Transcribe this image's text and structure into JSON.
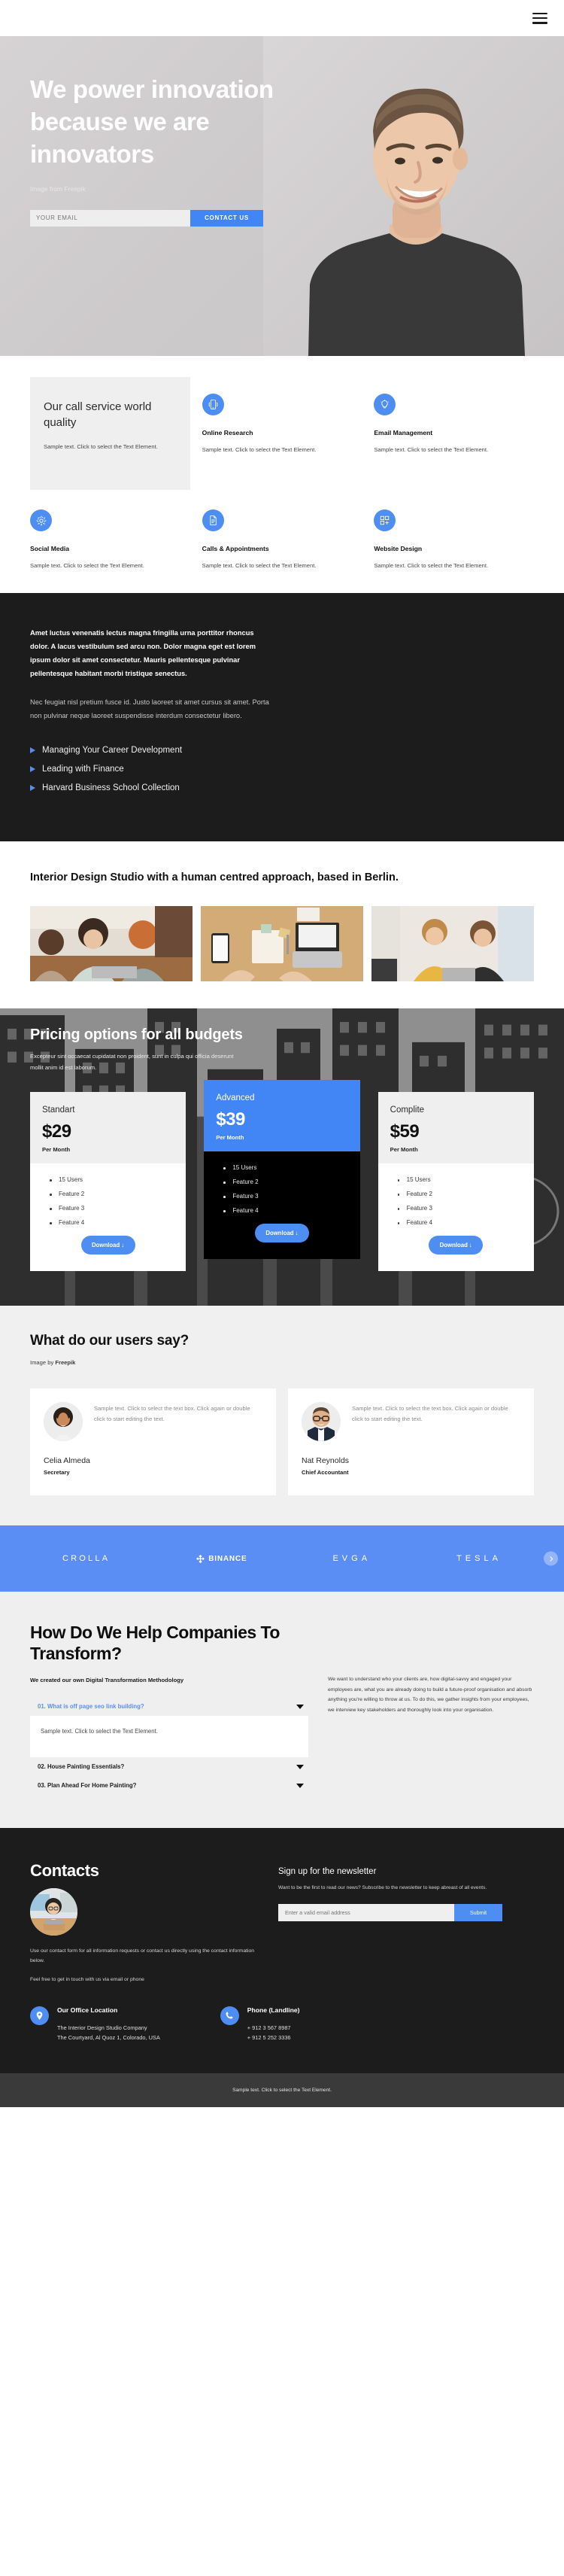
{
  "topbar": {
    "menu_icon": "hamburger-menu-icon"
  },
  "hero": {
    "title": "We power innovation because we are innovators",
    "credit": "Image from Freepik",
    "email_placeholder": "YOUR EMAIL",
    "email_value": "",
    "cta_label": "CONTACT US"
  },
  "services": {
    "promo": {
      "title": "Our call service world quality",
      "text": "Sample text. Click to select the Text Element."
    },
    "items": [
      {
        "icon": "mobile-phone-icon",
        "title": "Online Research",
        "text": "Sample text. Click to select the Text Element."
      },
      {
        "icon": "lightbulb-icon",
        "title": "Email Management",
        "text": "Sample text. Click to select the Text Element."
      },
      {
        "icon": "gear-icon",
        "title": "Social Media",
        "text": "Sample text. Click to select the Text Element."
      },
      {
        "icon": "document-list-icon",
        "title": "Calls & Appointments",
        "text": "Sample text. Click to select the Text Element."
      },
      {
        "icon": "grid-plus-icon",
        "title": "Website Design",
        "text": "Sample text. Click to select the Text Element."
      }
    ]
  },
  "dark_section": {
    "lead": "Amet luctus venenatis lectus magna fringilla urna porttitor rhoncus dolor. A lacus vestibulum sed arcu non. Dolor magna eget est lorem ipsum dolor sit amet consectetur. Mauris pellentesque pulvinar pellentesque habitant morbi tristique senectus.",
    "sub": "Nec feugiat nisl pretium fusce id. Justo laoreet sit amet cursus sit amet. Porta non pulvinar neque laoreet suspendisse interdum consectetur libero.",
    "bullets": [
      "Managing Your Career Development",
      "Leading with Finance",
      "Harvard Business School Collection"
    ]
  },
  "studio": {
    "heading": "Interior Design Studio with a human centred approach, based in Berlin.",
    "gallery": [
      "team-at-laptop-photo",
      "desk-top-view-photo",
      "two-women-talking-photo"
    ]
  },
  "pricing": {
    "title": "Pricing options for all budgets",
    "description": "Excepteur sint occaecat cupidatat non proident, sunt in culpa qui officia deserunt mollit anim id est laborum.",
    "plans": [
      {
        "name": "Standart",
        "price": "$29",
        "period": "Per Month",
        "features": [
          "15 Users",
          "Feature 2",
          "Feature 3",
          "Feature 4"
        ],
        "button": "Download ↓",
        "featured": false
      },
      {
        "name": "Advanced",
        "price": "$39",
        "period": "Per Month",
        "features": [
          "15 Users",
          "Feature 2",
          "Feature 3",
          "Feature 4"
        ],
        "button": "Download ↓",
        "featured": true
      },
      {
        "name": "Complite",
        "price": "$59",
        "period": "Per Month",
        "features": [
          "15 Users",
          "Feature 2",
          "Feature 3",
          "Feature 4"
        ],
        "button": "Download ↓",
        "featured": false
      }
    ]
  },
  "testimonials": {
    "title": "What do our users say?",
    "credit_prefix": "Image by ",
    "credit_name": "Freepik",
    "items": [
      {
        "quote": "Sample text. Click to select the text box. Click again or double click to start editing the text.",
        "name": "Celia Almeda",
        "role": "Secretary",
        "avatar": "woman-portrait-avatar"
      },
      {
        "quote": "Sample text. Click to select the text box. Click again or double click to start editing the text.",
        "name": "Nat Reynolds",
        "role": "Chief Accountant",
        "avatar": "man-with-glasses-avatar"
      }
    ]
  },
  "logos": {
    "background": "#5b8ef4",
    "items": [
      "CROLLA",
      "BINANCE",
      "EVGA",
      "TESLA"
    ],
    "next_icon": "chevron-right-icon"
  },
  "faq": {
    "heading": "How Do We Help Companies To Transform?",
    "methodology": "We created our own Digital Transformation Methodology",
    "items": [
      {
        "question": "01. What is off page seo link building?",
        "answer": "Sample text. Click to select the Text Element.",
        "open": true
      },
      {
        "question": "02. House Painting Essentials?",
        "answer": "",
        "open": false
      },
      {
        "question": "03. Plan Ahead For Home Painting?",
        "answer": "",
        "open": false
      }
    ],
    "side_text": "We want to understand who your clients are, how digital-savvy and engaged your employees are, what you are already doing to build a future-proof organisation and absorb anything you're willing to throw at us. To do this, we gather insights from your employees, we interview key stakeholders and thoroughly look into your organisation."
  },
  "contacts": {
    "title": "Contacts",
    "avatar": "woman-at-laptop-avatar",
    "text1": "Use our contact form for all information requests or contact us directly using the contact information below.",
    "text2": "Feel free to get in touch with us via email or phone",
    "newsletter": {
      "title": "Sign up for the newsletter",
      "text": "Want to be the first to read our news? Subscribe to the newsletter to keep abreast of all events.",
      "placeholder": "Enter a valid email address",
      "value": "",
      "submit": "Submit"
    },
    "office": {
      "icon": "map-pin-icon",
      "title": "Our Office Location",
      "lines": [
        "The Interior Design Studio Company",
        "The Courtyard, Al Quoz 1, Colorado,  USA"
      ]
    },
    "phone": {
      "icon": "phone-icon",
      "title": "Phone (Landline)",
      "lines": [
        "+ 912 3 567 8987",
        "+ 912 5 252 3336"
      ]
    }
  },
  "bottom_bar": {
    "text": "Sample text. Click to select the Text Element."
  }
}
